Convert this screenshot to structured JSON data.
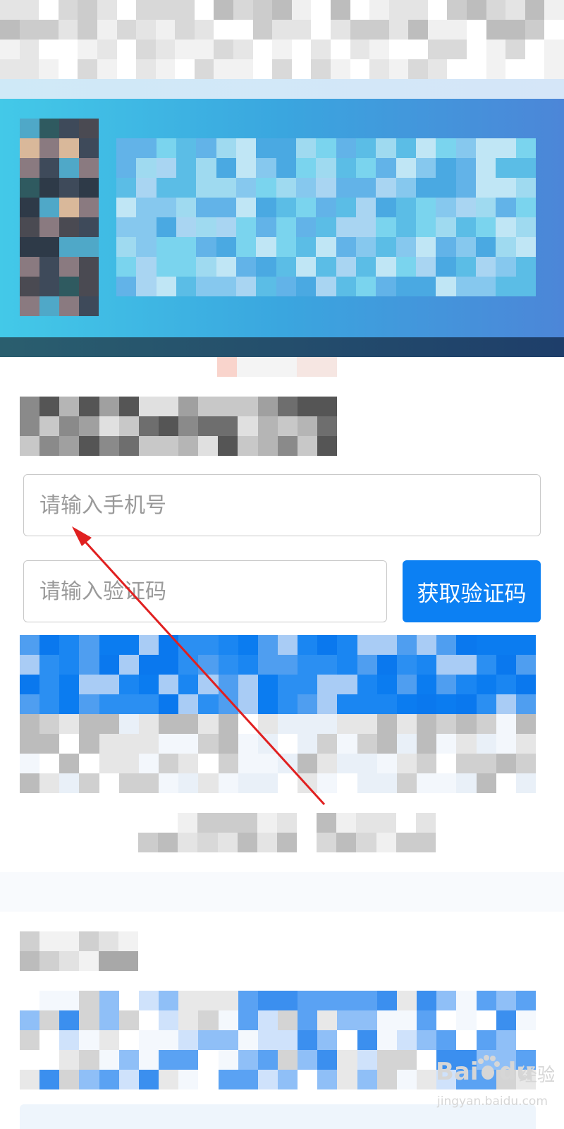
{
  "form": {
    "phone_placeholder": "请输入手机号",
    "code_placeholder": "请输入验证码",
    "get_code_label": "获取验证码"
  },
  "watermark": {
    "brand": "Bai",
    "brand_suffix": "du",
    "product": "经验",
    "site": "jingyan.baidu.com"
  },
  "colors": {
    "primary_blue": "#0c80f3",
    "annotation_red": "#e02020",
    "banner_start": "#43c9e8",
    "banner_end": "#4c86d8"
  },
  "icons": [
    "paw-icon"
  ]
}
